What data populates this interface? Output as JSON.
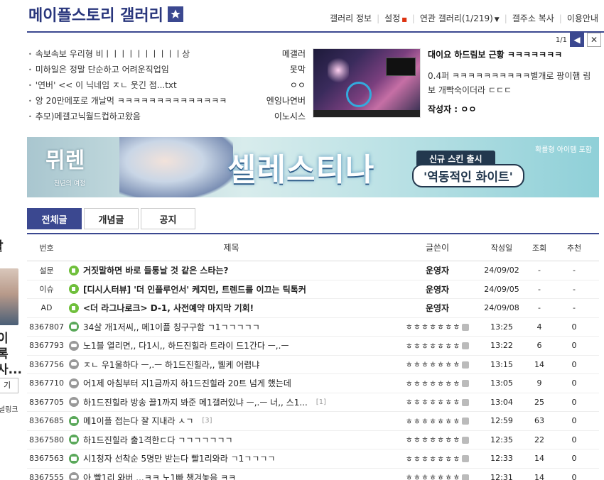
{
  "left_strip": {
    "lines": [
      "할",
      "이",
      "록",
      "사...",
      "기",
      "널링크"
    ]
  },
  "header": {
    "title": "메이플스토리 갤러리",
    "nav": [
      "갤러리 정보",
      "설정",
      "연관 갤러리(1/219)",
      "갤주소 복사",
      "이용안내"
    ],
    "pager": "1/1"
  },
  "news": [
    {
      "title": "속보속보 우리형 비ㅣㅣㅣㅣㅣㅣㅣㅣㅣㅣ상",
      "writer": "메갤러"
    },
    {
      "title": "미하일은 정말 단순하고 어려운직업임",
      "writer": "못막"
    },
    {
      "title": "'연버' << 이 닉네임 ㅈㄴ 웃긴 점...txt",
      "writer": "ㅇㅇ"
    },
    {
      "title": "앙 20만메포로 개날먹 ㅋㅋㅋㅋㅋㅋㅋㅋㅋㅋㅋㅋㅋㅋ",
      "writer": "엔잉나연버"
    },
    {
      "title": "추모)메갤고닉월드컵하고왔음",
      "writer": "이노시스"
    }
  ],
  "featured": {
    "title": "대이요 하드림보 근황 ㅋㅋㅋㅋㅋㅋㅋ",
    "body": "0.4퍼 ㅋㅋㅋㅋㅋㅋㅋㅋㅋㅋ별개로 팡이햄 림보 개빡숙이더라 ㄷㄷㄷ",
    "author": "작성자 : ㅇㅇ"
  },
  "banner": {
    "logo": "뮈렌",
    "logo_sub": "천년의 여정",
    "headline": "셀레스티나",
    "pill1": "신규 스킨 출시",
    "pill2": "'역동적인 화이트'",
    "note": "확률형 아이템 포함"
  },
  "tabs": [
    "전체글",
    "개념글",
    "공지"
  ],
  "table": {
    "headers": {
      "no": "번호",
      "title": "제목",
      "writer": "글쓴이",
      "date": "작성일",
      "views": "조회",
      "rec": "추천"
    },
    "rows": [
      {
        "no": "설문",
        "title": "거짓말하면 바로 들통날 것 같은 스타는?",
        "writer": "운영자",
        "date": "24/09/02",
        "views": "-",
        "rec": "-",
        "icon": "notice",
        "bold": true,
        "comments": ""
      },
      {
        "no": "이슈",
        "title": "[디시人터뷰] '더 인플루언서' 케지민, 트렌드를 이끄는 틱톡커",
        "writer": "운영자",
        "date": "24/09/05",
        "views": "-",
        "rec": "-",
        "icon": "notice",
        "bold": true,
        "comments": ""
      },
      {
        "no": "AD",
        "title": "<더 라그나로크> D-1, 사전예약 마지막 기회!",
        "writer": "운영자",
        "date": "24/09/08",
        "views": "-",
        "rec": "-",
        "icon": "notice",
        "bold": true,
        "comments": ""
      },
      {
        "no": "8367807",
        "title": "34살 개1저씨,, 메1이플 칭구구함 ㄱ1ㄱㄱㄱㄱㄱ",
        "writer": "ㅎㅎㅎㅎㅎㅎㅎ",
        "date": "13:25",
        "views": "4",
        "rec": "0",
        "icon": "img",
        "bold": false,
        "comments": ""
      },
      {
        "no": "8367793",
        "title": "노1블 열리면,, 다1시,, 하드진힐라 트라이 드1간다 ㅡ,.ㅡ",
        "writer": "ㅎㅎㅎㅎㅎㅎㅎ",
        "date": "13:22",
        "views": "6",
        "rec": "0",
        "icon": "chat",
        "bold": false,
        "comments": ""
      },
      {
        "no": "8367756",
        "title": "ㅈㄴ 우1울하다 ㅡ,.ㅡ 하1드진힐라,, 웰케 어렵냐",
        "writer": "ㅎㅎㅎㅎㅎㅎㅎ",
        "date": "13:15",
        "views": "14",
        "rec": "0",
        "icon": "chat",
        "bold": false,
        "comments": ""
      },
      {
        "no": "8367710",
        "title": "어1제 아침부터 지1금까지 하1드진힐라 20트 넘게 했는데",
        "writer": "ㅎㅎㅎㅎㅎㅎㅎ",
        "date": "13:05",
        "views": "9",
        "rec": "0",
        "icon": "chat",
        "bold": false,
        "comments": ""
      },
      {
        "no": "8367705",
        "title": "하1드진힐라 방송 끌1까지 봐준 메1갤러있냐 ㅡ,.ㅡ 너,, 스1...",
        "writer": "ㅎㅎㅎㅎㅎㅎㅎ",
        "date": "13:04",
        "views": "25",
        "rec": "0",
        "icon": "chat",
        "bold": false,
        "comments": "[1]"
      },
      {
        "no": "8367685",
        "title": "메1이플 접는다 잘 지내라 ㅅㄱ",
        "writer": "ㅎㅎㅎㅎㅎㅎㅎ",
        "date": "12:59",
        "views": "63",
        "rec": "0",
        "icon": "img",
        "bold": false,
        "comments": "[3]"
      },
      {
        "no": "8367580",
        "title": "하1드진힐라 출1격한ㄷ다 ㄱㄱㄱㄱㄱㄱㄱ",
        "writer": "ㅎㅎㅎㅎㅎㅎㅎ",
        "date": "12:35",
        "views": "22",
        "rec": "0",
        "icon": "img",
        "bold": false,
        "comments": ""
      },
      {
        "no": "8367563",
        "title": "시1청자 선착순 5명만 받는다 빨1리와라 ㄱ1ㄱㄱㄱㄱ",
        "writer": "ㅎㅎㅎㅎㅎㅎㅎ",
        "date": "12:33",
        "views": "14",
        "rec": "0",
        "icon": "img",
        "bold": false,
        "comments": ""
      },
      {
        "no": "8367555",
        "title": "아 빨1리 와버 ...ㅋㅋ 노1빠 챙겨놓음 ㅋㅋ",
        "writer": "ㅎㅎㅎㅎㅎㅎㅎ",
        "date": "12:31",
        "views": "14",
        "rec": "0",
        "icon": "chat",
        "bold": false,
        "comments": ""
      }
    ]
  }
}
